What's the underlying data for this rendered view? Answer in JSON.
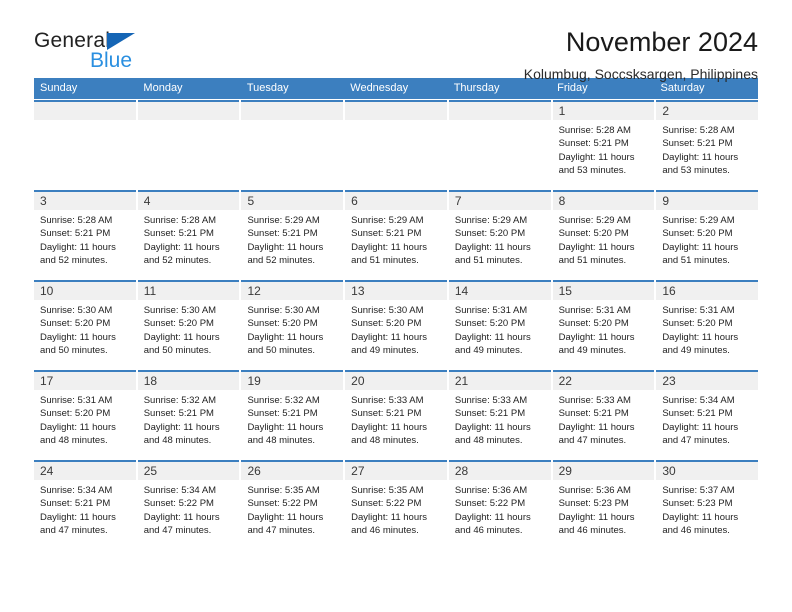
{
  "brand": {
    "name_part1": "General",
    "name_part2": "Blue",
    "accent_color": "#2a8fe0",
    "triangle_color": "#1565b5"
  },
  "header": {
    "title": "November 2024",
    "subtitle": "Kolumbug, Soccsksargen, Philippines"
  },
  "calendar": {
    "header_background": "#3c7fbf",
    "weekdays": [
      "Sunday",
      "Monday",
      "Tuesday",
      "Wednesday",
      "Thursday",
      "Friday",
      "Saturday"
    ],
    "weeks": [
      [
        {
          "day": "",
          "lines": []
        },
        {
          "day": "",
          "lines": []
        },
        {
          "day": "",
          "lines": []
        },
        {
          "day": "",
          "lines": []
        },
        {
          "day": "",
          "lines": []
        },
        {
          "day": "1",
          "lines": [
            "Sunrise: 5:28 AM",
            "Sunset: 5:21 PM",
            "Daylight: 11 hours",
            "and 53 minutes."
          ]
        },
        {
          "day": "2",
          "lines": [
            "Sunrise: 5:28 AM",
            "Sunset: 5:21 PM",
            "Daylight: 11 hours",
            "and 53 minutes."
          ]
        }
      ],
      [
        {
          "day": "3",
          "lines": [
            "Sunrise: 5:28 AM",
            "Sunset: 5:21 PM",
            "Daylight: 11 hours",
            "and 52 minutes."
          ]
        },
        {
          "day": "4",
          "lines": [
            "Sunrise: 5:28 AM",
            "Sunset: 5:21 PM",
            "Daylight: 11 hours",
            "and 52 minutes."
          ]
        },
        {
          "day": "5",
          "lines": [
            "Sunrise: 5:29 AM",
            "Sunset: 5:21 PM",
            "Daylight: 11 hours",
            "and 52 minutes."
          ]
        },
        {
          "day": "6",
          "lines": [
            "Sunrise: 5:29 AM",
            "Sunset: 5:21 PM",
            "Daylight: 11 hours",
            "and 51 minutes."
          ]
        },
        {
          "day": "7",
          "lines": [
            "Sunrise: 5:29 AM",
            "Sunset: 5:20 PM",
            "Daylight: 11 hours",
            "and 51 minutes."
          ]
        },
        {
          "day": "8",
          "lines": [
            "Sunrise: 5:29 AM",
            "Sunset: 5:20 PM",
            "Daylight: 11 hours",
            "and 51 minutes."
          ]
        },
        {
          "day": "9",
          "lines": [
            "Sunrise: 5:29 AM",
            "Sunset: 5:20 PM",
            "Daylight: 11 hours",
            "and 51 minutes."
          ]
        }
      ],
      [
        {
          "day": "10",
          "lines": [
            "Sunrise: 5:30 AM",
            "Sunset: 5:20 PM",
            "Daylight: 11 hours",
            "and 50 minutes."
          ]
        },
        {
          "day": "11",
          "lines": [
            "Sunrise: 5:30 AM",
            "Sunset: 5:20 PM",
            "Daylight: 11 hours",
            "and 50 minutes."
          ]
        },
        {
          "day": "12",
          "lines": [
            "Sunrise: 5:30 AM",
            "Sunset: 5:20 PM",
            "Daylight: 11 hours",
            "and 50 minutes."
          ]
        },
        {
          "day": "13",
          "lines": [
            "Sunrise: 5:30 AM",
            "Sunset: 5:20 PM",
            "Daylight: 11 hours",
            "and 49 minutes."
          ]
        },
        {
          "day": "14",
          "lines": [
            "Sunrise: 5:31 AM",
            "Sunset: 5:20 PM",
            "Daylight: 11 hours",
            "and 49 minutes."
          ]
        },
        {
          "day": "15",
          "lines": [
            "Sunrise: 5:31 AM",
            "Sunset: 5:20 PM",
            "Daylight: 11 hours",
            "and 49 minutes."
          ]
        },
        {
          "day": "16",
          "lines": [
            "Sunrise: 5:31 AM",
            "Sunset: 5:20 PM",
            "Daylight: 11 hours",
            "and 49 minutes."
          ]
        }
      ],
      [
        {
          "day": "17",
          "lines": [
            "Sunrise: 5:31 AM",
            "Sunset: 5:20 PM",
            "Daylight: 11 hours",
            "and 48 minutes."
          ]
        },
        {
          "day": "18",
          "lines": [
            "Sunrise: 5:32 AM",
            "Sunset: 5:21 PM",
            "Daylight: 11 hours",
            "and 48 minutes."
          ]
        },
        {
          "day": "19",
          "lines": [
            "Sunrise: 5:32 AM",
            "Sunset: 5:21 PM",
            "Daylight: 11 hours",
            "and 48 minutes."
          ]
        },
        {
          "day": "20",
          "lines": [
            "Sunrise: 5:33 AM",
            "Sunset: 5:21 PM",
            "Daylight: 11 hours",
            "and 48 minutes."
          ]
        },
        {
          "day": "21",
          "lines": [
            "Sunrise: 5:33 AM",
            "Sunset: 5:21 PM",
            "Daylight: 11 hours",
            "and 48 minutes."
          ]
        },
        {
          "day": "22",
          "lines": [
            "Sunrise: 5:33 AM",
            "Sunset: 5:21 PM",
            "Daylight: 11 hours",
            "and 47 minutes."
          ]
        },
        {
          "day": "23",
          "lines": [
            "Sunrise: 5:34 AM",
            "Sunset: 5:21 PM",
            "Daylight: 11 hours",
            "and 47 minutes."
          ]
        }
      ],
      [
        {
          "day": "24",
          "lines": [
            "Sunrise: 5:34 AM",
            "Sunset: 5:21 PM",
            "Daylight: 11 hours",
            "and 47 minutes."
          ]
        },
        {
          "day": "25",
          "lines": [
            "Sunrise: 5:34 AM",
            "Sunset: 5:22 PM",
            "Daylight: 11 hours",
            "and 47 minutes."
          ]
        },
        {
          "day": "26",
          "lines": [
            "Sunrise: 5:35 AM",
            "Sunset: 5:22 PM",
            "Daylight: 11 hours",
            "and 47 minutes."
          ]
        },
        {
          "day": "27",
          "lines": [
            "Sunrise: 5:35 AM",
            "Sunset: 5:22 PM",
            "Daylight: 11 hours",
            "and 46 minutes."
          ]
        },
        {
          "day": "28",
          "lines": [
            "Sunrise: 5:36 AM",
            "Sunset: 5:22 PM",
            "Daylight: 11 hours",
            "and 46 minutes."
          ]
        },
        {
          "day": "29",
          "lines": [
            "Sunrise: 5:36 AM",
            "Sunset: 5:23 PM",
            "Daylight: 11 hours",
            "and 46 minutes."
          ]
        },
        {
          "day": "30",
          "lines": [
            "Sunrise: 5:37 AM",
            "Sunset: 5:23 PM",
            "Daylight: 11 hours",
            "and 46 minutes."
          ]
        }
      ]
    ]
  }
}
